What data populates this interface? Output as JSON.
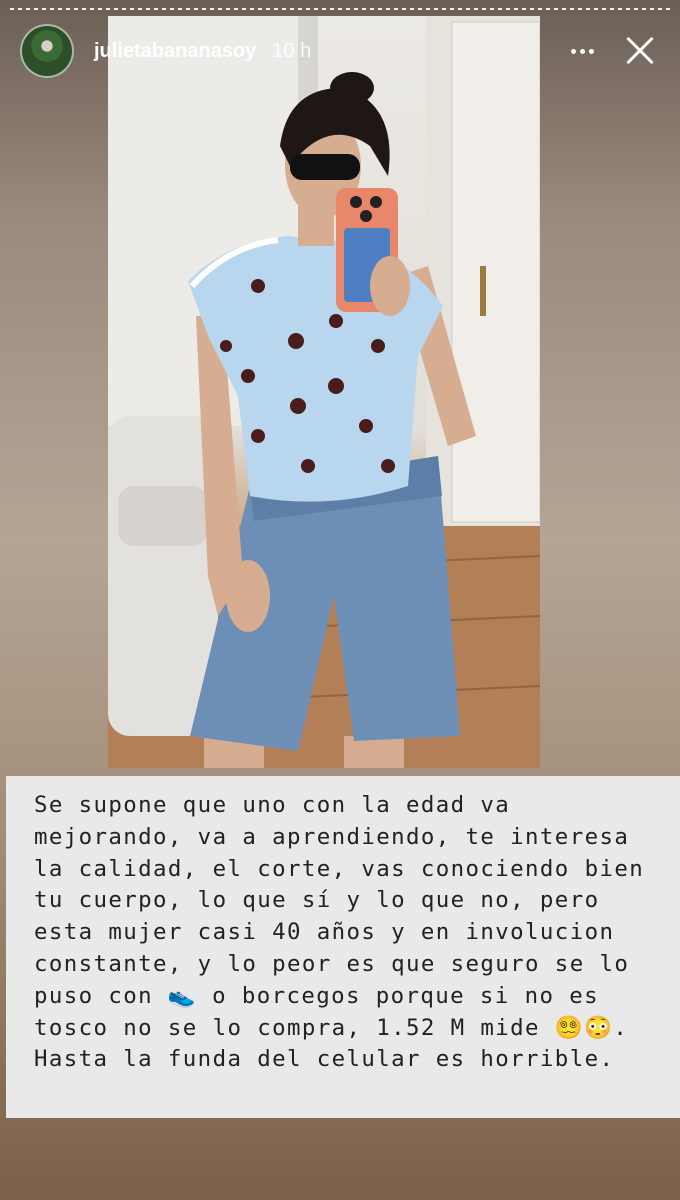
{
  "story": {
    "username": "julietabananasoy",
    "time": "10 h",
    "more_icon": "more-horizontal-icon",
    "close_icon": "close-icon"
  },
  "caption": {
    "text": "Se supone que uno con la edad va mejorando, va a aprendiendo, te interesa la calidad, el corte, vas conociendo bien tu cuerpo, lo que sí y lo que no, pero esta mujer casi 40 años y en involucion constante, y lo peor es que seguro se lo puso con 👟 o borcegos porque si no es tosco no se lo compra, 1.52 M mide 😵‍💫😳. Hasta la funda del celular es horrible."
  },
  "colors": {
    "caption_bg": "#e9e9e9",
    "shirt": "#b8d6ee",
    "dots": "#4a1c1c",
    "denim": "#6e8fb5"
  }
}
